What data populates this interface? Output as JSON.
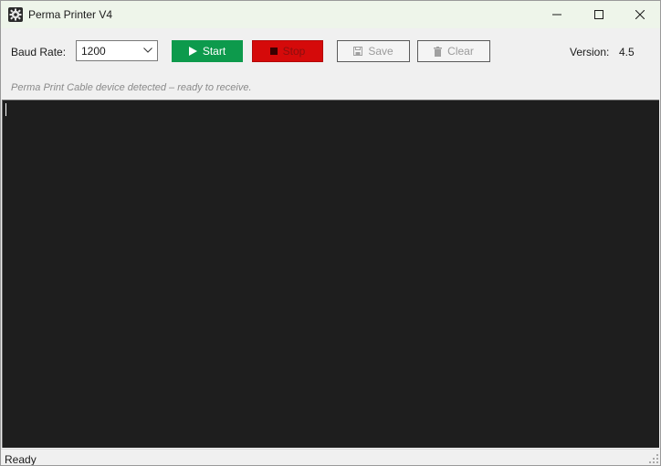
{
  "window": {
    "title": "Perma Printer V4"
  },
  "toolbar": {
    "baud_label": "Baud Rate:",
    "baud_value": "1200",
    "start_label": "Start",
    "stop_label": "Stop",
    "save_label": "Save",
    "clear_label": "Clear",
    "version_label": "Version:",
    "version_value": "4.5"
  },
  "status_message": "Perma Print Cable device detected – ready to receive.",
  "statusbar": {
    "text": "Ready"
  },
  "colors": {
    "start": "#0d9a4c",
    "stop": "#d50a0a",
    "output_bg": "#1e1e1e",
    "titlebar_bg": "#eef5ea"
  },
  "icons": {
    "app": "gear-icon",
    "start": "play-icon",
    "stop": "stop-icon",
    "save": "floppy-icon",
    "clear": "trash-icon"
  }
}
